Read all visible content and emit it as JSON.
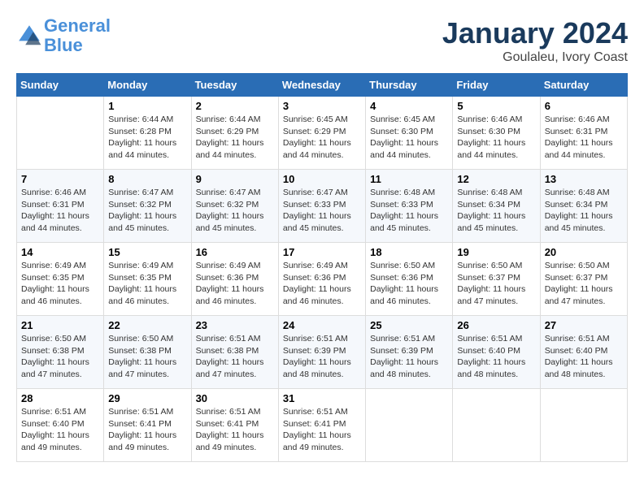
{
  "logo": {
    "line1": "General",
    "line2": "Blue"
  },
  "title": "January 2024",
  "subtitle": "Goulaleu, Ivory Coast",
  "days_of_week": [
    "Sunday",
    "Monday",
    "Tuesday",
    "Wednesday",
    "Thursday",
    "Friday",
    "Saturday"
  ],
  "weeks": [
    [
      {
        "day": "",
        "info": ""
      },
      {
        "day": "1",
        "info": "Sunrise: 6:44 AM\nSunset: 6:28 PM\nDaylight: 11 hours and 44 minutes."
      },
      {
        "day": "2",
        "info": "Sunrise: 6:44 AM\nSunset: 6:29 PM\nDaylight: 11 hours and 44 minutes."
      },
      {
        "day": "3",
        "info": "Sunrise: 6:45 AM\nSunset: 6:29 PM\nDaylight: 11 hours and 44 minutes."
      },
      {
        "day": "4",
        "info": "Sunrise: 6:45 AM\nSunset: 6:30 PM\nDaylight: 11 hours and 44 minutes."
      },
      {
        "day": "5",
        "info": "Sunrise: 6:46 AM\nSunset: 6:30 PM\nDaylight: 11 hours and 44 minutes."
      },
      {
        "day": "6",
        "info": "Sunrise: 6:46 AM\nSunset: 6:31 PM\nDaylight: 11 hours and 44 minutes."
      }
    ],
    [
      {
        "day": "7",
        "info": "Sunrise: 6:46 AM\nSunset: 6:31 PM\nDaylight: 11 hours and 44 minutes."
      },
      {
        "day": "8",
        "info": "Sunrise: 6:47 AM\nSunset: 6:32 PM\nDaylight: 11 hours and 45 minutes."
      },
      {
        "day": "9",
        "info": "Sunrise: 6:47 AM\nSunset: 6:32 PM\nDaylight: 11 hours and 45 minutes."
      },
      {
        "day": "10",
        "info": "Sunrise: 6:47 AM\nSunset: 6:33 PM\nDaylight: 11 hours and 45 minutes."
      },
      {
        "day": "11",
        "info": "Sunrise: 6:48 AM\nSunset: 6:33 PM\nDaylight: 11 hours and 45 minutes."
      },
      {
        "day": "12",
        "info": "Sunrise: 6:48 AM\nSunset: 6:34 PM\nDaylight: 11 hours and 45 minutes."
      },
      {
        "day": "13",
        "info": "Sunrise: 6:48 AM\nSunset: 6:34 PM\nDaylight: 11 hours and 45 minutes."
      }
    ],
    [
      {
        "day": "14",
        "info": "Sunrise: 6:49 AM\nSunset: 6:35 PM\nDaylight: 11 hours and 46 minutes."
      },
      {
        "day": "15",
        "info": "Sunrise: 6:49 AM\nSunset: 6:35 PM\nDaylight: 11 hours and 46 minutes."
      },
      {
        "day": "16",
        "info": "Sunrise: 6:49 AM\nSunset: 6:36 PM\nDaylight: 11 hours and 46 minutes."
      },
      {
        "day": "17",
        "info": "Sunrise: 6:49 AM\nSunset: 6:36 PM\nDaylight: 11 hours and 46 minutes."
      },
      {
        "day": "18",
        "info": "Sunrise: 6:50 AM\nSunset: 6:36 PM\nDaylight: 11 hours and 46 minutes."
      },
      {
        "day": "19",
        "info": "Sunrise: 6:50 AM\nSunset: 6:37 PM\nDaylight: 11 hours and 47 minutes."
      },
      {
        "day": "20",
        "info": "Sunrise: 6:50 AM\nSunset: 6:37 PM\nDaylight: 11 hours and 47 minutes."
      }
    ],
    [
      {
        "day": "21",
        "info": "Sunrise: 6:50 AM\nSunset: 6:38 PM\nDaylight: 11 hours and 47 minutes."
      },
      {
        "day": "22",
        "info": "Sunrise: 6:50 AM\nSunset: 6:38 PM\nDaylight: 11 hours and 47 minutes."
      },
      {
        "day": "23",
        "info": "Sunrise: 6:51 AM\nSunset: 6:38 PM\nDaylight: 11 hours and 47 minutes."
      },
      {
        "day": "24",
        "info": "Sunrise: 6:51 AM\nSunset: 6:39 PM\nDaylight: 11 hours and 48 minutes."
      },
      {
        "day": "25",
        "info": "Sunrise: 6:51 AM\nSunset: 6:39 PM\nDaylight: 11 hours and 48 minutes."
      },
      {
        "day": "26",
        "info": "Sunrise: 6:51 AM\nSunset: 6:40 PM\nDaylight: 11 hours and 48 minutes."
      },
      {
        "day": "27",
        "info": "Sunrise: 6:51 AM\nSunset: 6:40 PM\nDaylight: 11 hours and 48 minutes."
      }
    ],
    [
      {
        "day": "28",
        "info": "Sunrise: 6:51 AM\nSunset: 6:40 PM\nDaylight: 11 hours and 49 minutes."
      },
      {
        "day": "29",
        "info": "Sunrise: 6:51 AM\nSunset: 6:41 PM\nDaylight: 11 hours and 49 minutes."
      },
      {
        "day": "30",
        "info": "Sunrise: 6:51 AM\nSunset: 6:41 PM\nDaylight: 11 hours and 49 minutes."
      },
      {
        "day": "31",
        "info": "Sunrise: 6:51 AM\nSunset: 6:41 PM\nDaylight: 11 hours and 49 minutes."
      },
      {
        "day": "",
        "info": ""
      },
      {
        "day": "",
        "info": ""
      },
      {
        "day": "",
        "info": ""
      }
    ]
  ]
}
